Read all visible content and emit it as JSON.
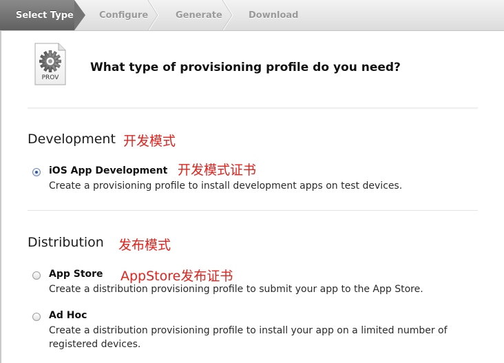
{
  "steps": {
    "items": [
      {
        "label": "Select Type"
      },
      {
        "label": "Configure"
      },
      {
        "label": "Generate"
      },
      {
        "label": "Download"
      }
    ]
  },
  "header": {
    "icon_label": "PROV",
    "question": "What type of provisioning profile do you need?"
  },
  "development": {
    "title": "Development",
    "annotation": "开发模式",
    "options": [
      {
        "title": "iOS App Development",
        "annotation": "开发模式证书",
        "description": "Create a provisioning profile to install development apps on test devices.",
        "selected": true
      }
    ]
  },
  "distribution": {
    "title": "Distribution",
    "annotation": "发布模式",
    "options": [
      {
        "title": "App Store",
        "annotation": "AppStore发布证书",
        "description": "Create a distribution provisioning profile to submit your app to the App Store.",
        "selected": false
      },
      {
        "title": "Ad Hoc",
        "description": "Create a distribution provisioning profile to install your app on a limited number of registered devices.",
        "selected": false
      }
    ]
  },
  "colors": {
    "annotation": "#e8201a",
    "active_step": "#6e6e6e",
    "radio_selected": "#2a56a8"
  }
}
